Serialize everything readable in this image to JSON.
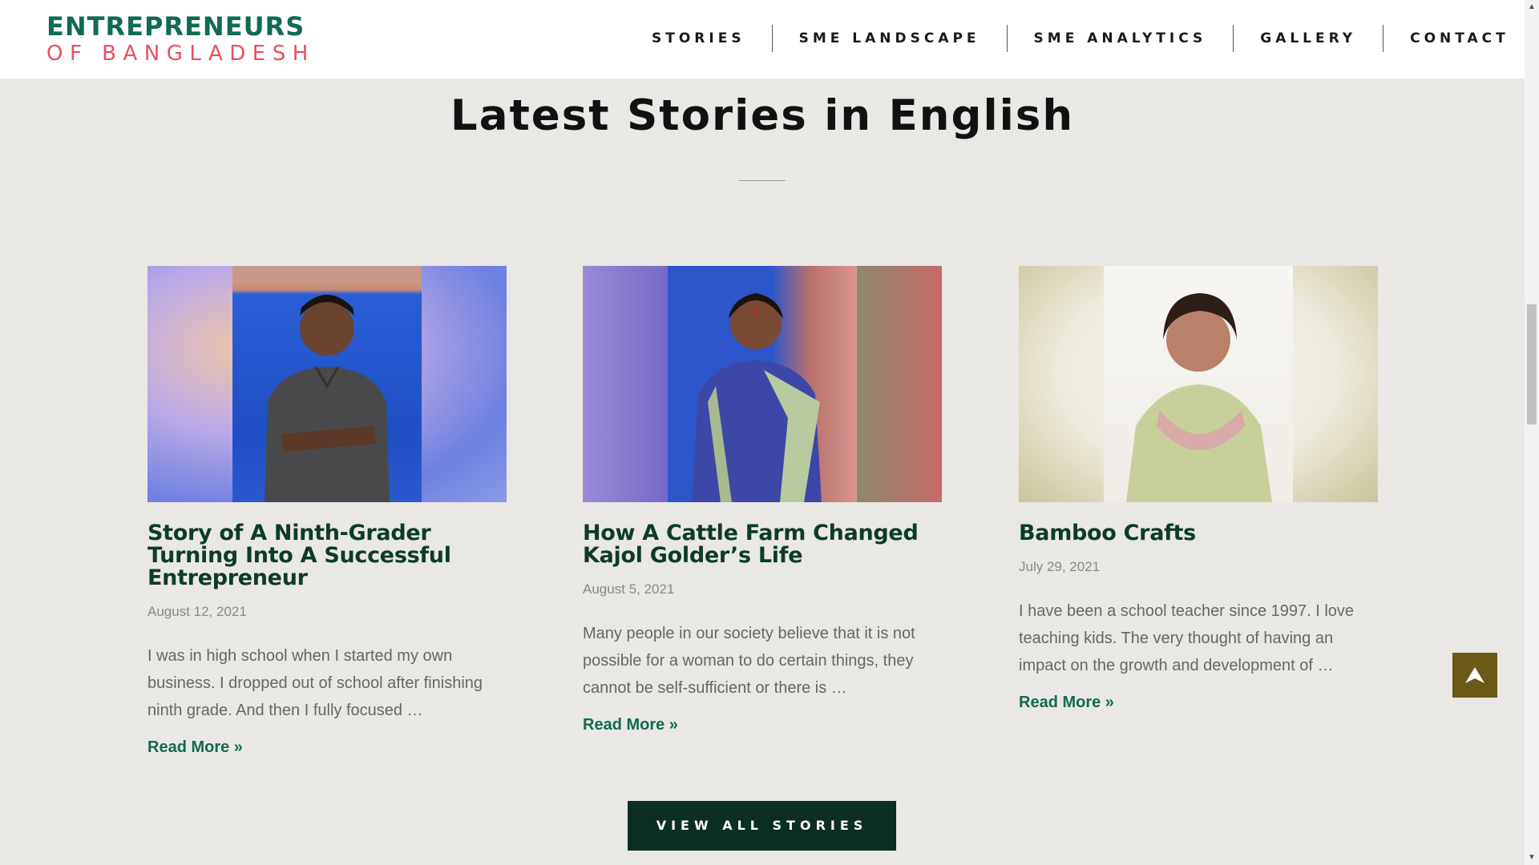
{
  "brand": {
    "line1": "ENTREPRENEURS",
    "line2": "OF BANGLADESH",
    "primary_color": "#0f6b52",
    "accent_color": "#e8505b"
  },
  "nav": {
    "items": [
      "STORIES",
      "SME LANDSCAPE",
      "SME ANALYTICS",
      "GALLERY",
      "CONTACT"
    ]
  },
  "section": {
    "title": "Latest Stories in English"
  },
  "stories": [
    {
      "title": "Story of A Ninth-Grader Turning Into A Successful Entrepreneur",
      "date": "August 12, 2021",
      "excerpt": "I was in high school when I started my own business. I dropped out of school after finishing ninth grade. And then I fully focused …",
      "read_more": "Read More »"
    },
    {
      "title": "How A Cattle Farm Changed Kajol Golder’s Life",
      "date": "August 5, 2021",
      "excerpt": "Many people in our society believe that it is not possible for a woman to do certain things, they cannot be self-sufficient or there is …",
      "read_more": "Read More »"
    },
    {
      "title": "Bamboo Crafts",
      "date": "July 29, 2021",
      "excerpt": "I have been a school teacher since 1997. I love teaching kids. The very thought of having an impact on the growth and development of …",
      "read_more": "Read More »"
    }
  ],
  "view_all_label": "VIEW ALL STORIES",
  "back_to_top_icon": "arrow-up-icon",
  "button_color": "#0d2e22",
  "back_to_top_color": "#6b5a17"
}
